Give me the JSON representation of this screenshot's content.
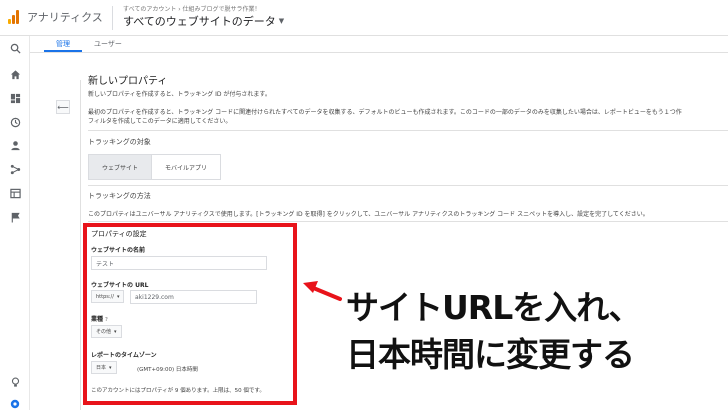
{
  "header": {
    "app_title": "アナリティクス",
    "breadcrumb": "すべてのアカウント › 仕組みブログで脱サラ作業！",
    "property_select": "すべてのウェブサイトのデータ",
    "logo_colors": [
      "#f9ab00",
      "#e37400",
      "#e37400"
    ]
  },
  "rail": {
    "icons": [
      "search-icon",
      "home-icon",
      "dashboard-icon",
      "clock-icon",
      "person-icon",
      "acquisition-icon",
      "behavior-icon",
      "flag-icon",
      "lightbulb-icon",
      "gear-icon"
    ]
  },
  "tabs": [
    {
      "label": "管理",
      "active": true
    },
    {
      "label": "ユーザー",
      "active": false
    }
  ],
  "main": {
    "title": "新しいプロパティ",
    "intro": "新しいプロパティを作成すると、トラッキング ID が付与されます。",
    "desc_line1": "最初のプロパティを作成すると、トラッキング コードに関連付けられたすべてのデータを収集する、デフォルトのビューも作成されます。このコードの一部のデータのみを収集したい場合は、レポートビューをもう１つ作",
    "desc_line2": "フィルタを作成してこのデータに適用してください。",
    "tracking_target_label": "トラッキングの対象",
    "segment": {
      "website": "ウェブサイト",
      "mobile": "モバイルアプリ"
    },
    "tracking_method_label": "トラッキングの方法",
    "tracking_method_text": "このプロパティはユニバーサル アナリティクスで使用します。[トラッキング ID を取得] をクリックして、ユニバーサル アナリティクスのトラッキング コード スニペットを導入し、設定を完了してください。"
  },
  "settings": {
    "title": "プロパティの設定",
    "site_name_label": "ウェブサイトの名前",
    "site_name_value": "テスト",
    "site_url_label": "ウェブサイトの URL",
    "protocol": "https://",
    "site_url_value": "aki1229.com",
    "industry_label": "業種",
    "help_mark": "?",
    "industry_value": "その他",
    "timezone_label": "レポートのタイムゾーン",
    "country": "日本",
    "timezone_value": "(GMT+09:00) 日本時間",
    "quota_text": "このアカウントにはプロパティが 9 個あります。上限は、50 個です。"
  },
  "annotation": {
    "line1": "サイトURLを入れ、",
    "line2": "日本時間に変更する",
    "highlight_color": "#e8131a"
  }
}
